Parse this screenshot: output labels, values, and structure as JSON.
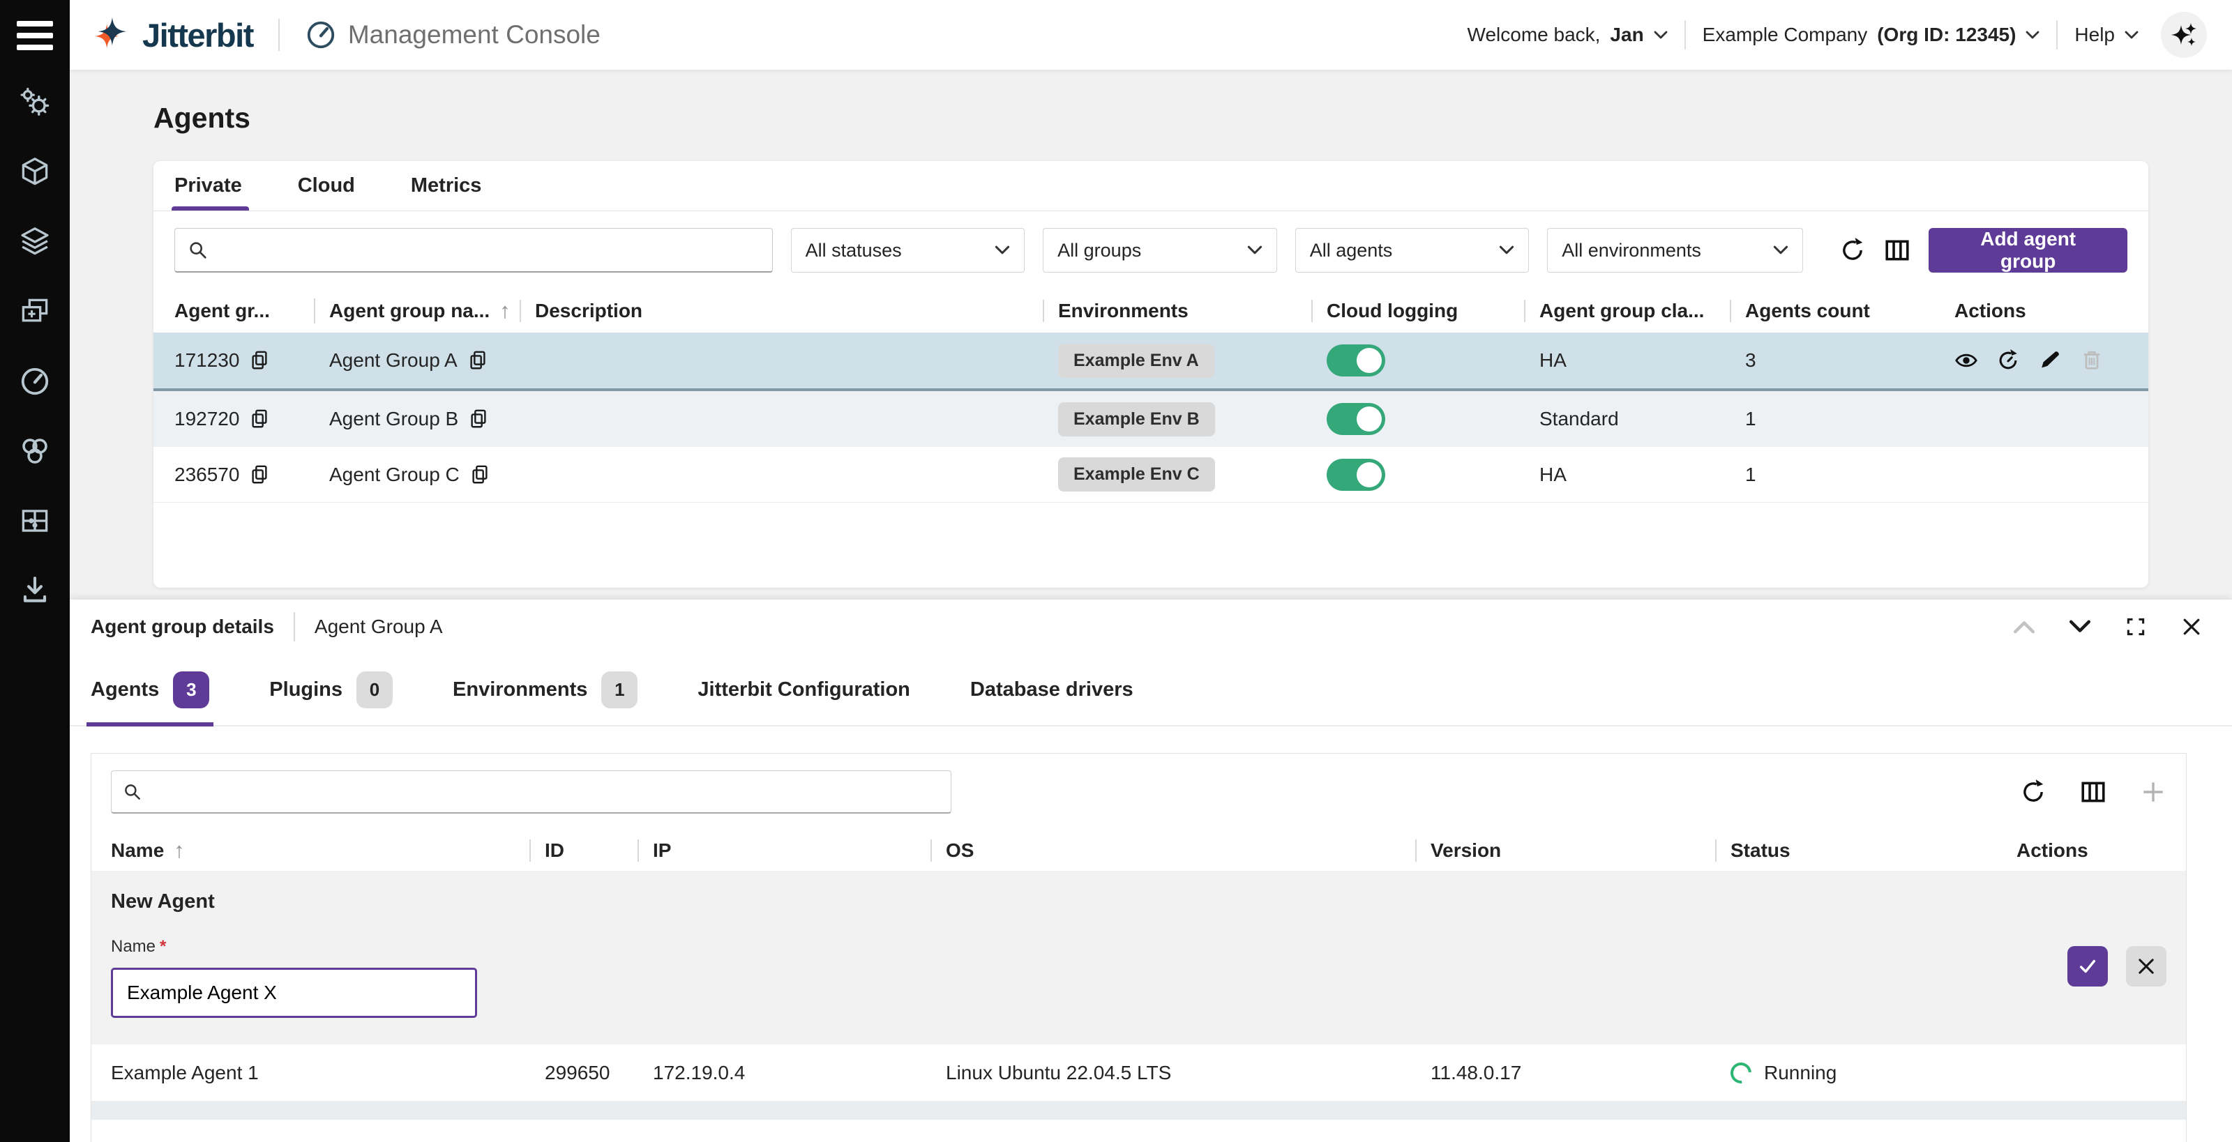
{
  "colors": {
    "accent": "#5d3b97",
    "toggle_on": "#35a87a",
    "running_green": "#2cb673",
    "selected_row": "#cfe0e8"
  },
  "topbar": {
    "brand": "Jitterbit",
    "console_label": "Management Console",
    "welcome_prefix": "Welcome back,",
    "user": "Jan",
    "company": "Example Company",
    "org_id": "(Org ID: 12345)",
    "help": "Help"
  },
  "sidebar": {
    "icon_names": [
      "menu",
      "settings-gears",
      "cube",
      "layers",
      "duplicate-add",
      "gauge",
      "integration-loops",
      "puzzle",
      "download"
    ]
  },
  "page": {
    "title": "Agents",
    "tabs": [
      {
        "label": "Private",
        "active": true
      },
      {
        "label": "Cloud",
        "active": false
      },
      {
        "label": "Metrics",
        "active": false
      }
    ]
  },
  "filters": {
    "statuses": "All statuses",
    "groups": "All groups",
    "agents": "All agents",
    "environments": "All environments",
    "add_button": "Add agent group"
  },
  "agent_groups": {
    "columns": [
      "Agent gr...",
      "Agent group na...",
      "Description",
      "Environments",
      "Cloud logging",
      "Agent group cla...",
      "Agents count",
      "Actions"
    ],
    "rows": [
      {
        "id": "171230",
        "name": "Agent Group A",
        "description": "",
        "environment": "Example Env A",
        "cloud_logging": true,
        "agent_group_class": "HA",
        "agents_count": "3",
        "selected": true
      },
      {
        "id": "192720",
        "name": "Agent Group B",
        "description": "",
        "environment": "Example Env B",
        "cloud_logging": true,
        "agent_group_class": "Standard",
        "agents_count": "1",
        "selected": false
      },
      {
        "id": "236570",
        "name": "Agent Group C",
        "description": "",
        "environment": "Example Env C",
        "cloud_logging": true,
        "agent_group_class": "HA",
        "agents_count": "1",
        "selected": false
      }
    ],
    "row_action_icons": [
      "view",
      "restore",
      "edit",
      "delete"
    ]
  },
  "details": {
    "title": "Agent group details",
    "subtitle": "Agent Group A",
    "header_icons": [
      "chevron-up",
      "chevron-down",
      "fullscreen",
      "close"
    ],
    "tabs": [
      {
        "label": "Agents",
        "badge": "3",
        "active": true
      },
      {
        "label": "Plugins",
        "badge": "0",
        "active": false
      },
      {
        "label": "Environments",
        "badge": "1",
        "active": false
      },
      {
        "label": "Jitterbit Configuration",
        "badge": "",
        "active": false
      },
      {
        "label": "Database drivers",
        "badge": "",
        "active": false
      }
    ],
    "toolbar_icons": [
      "refresh",
      "columns",
      "add"
    ],
    "agents_table": {
      "columns": [
        "Name",
        "ID",
        "IP",
        "OS",
        "Version",
        "Status",
        "Actions"
      ],
      "rows": [
        {
          "name": "Example Agent 1",
          "id": "299650",
          "ip": "172.19.0.4",
          "os": "Linux Ubuntu 22.04.5 LTS",
          "version": "11.48.0.17",
          "status": "Running"
        }
      ]
    },
    "new_agent": {
      "heading": "New Agent",
      "name_label": "Name",
      "required_mark": "*",
      "value": "Example Agent X"
    }
  }
}
